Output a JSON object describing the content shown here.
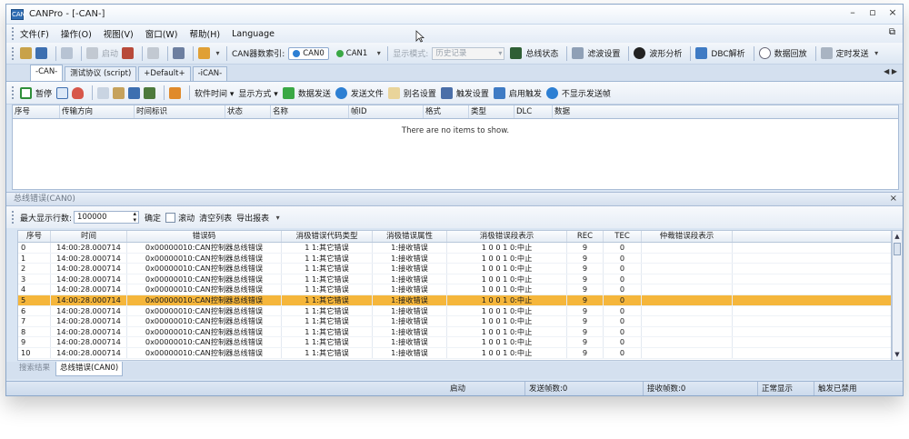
{
  "window": {
    "title": "CANPro - [-CAN-]",
    "app_icon_text": "CAN"
  },
  "menu": [
    "文件(F)",
    "操作(O)",
    "视图(V)",
    "窗口(W)",
    "帮助(H)",
    "Language"
  ],
  "toolbar1": {
    "start_label": "启动",
    "index_label": "CAN器数索引:",
    "channels": [
      {
        "label": "CAN0",
        "color": "#2d7fd3"
      },
      {
        "label": "CAN1",
        "color": "#3aa845"
      }
    ],
    "display_mode_label": "显示模式:",
    "display_mode_value": "历史记录",
    "bus_status_label": "总线状态",
    "filter_label": "滤波设置",
    "waveform_label": "波形分析",
    "dbc_label": "DBC解析",
    "replay_label": "数据回放",
    "timed_send_label": "定时发送"
  },
  "tabs": [
    "-CAN-",
    "测试协议 (script)",
    "+Default+",
    "-iCAN-"
  ],
  "toolbar2": {
    "pause_label": "暂停",
    "software_time_label": "软件时间",
    "display_style_label": "显示方式",
    "data_send_label": "数据发送",
    "file_send_label": "发送文件",
    "alias_label": "别名设置",
    "trigger_setting_label": "触发设置",
    "enable_trigger_label": "启用触发",
    "hide_send_label": "不显示发送帧"
  },
  "main_grid": {
    "columns": [
      "序号",
      "传输方向",
      "时间标识",
      "状态",
      "名称",
      "帧ID",
      "格式",
      "类型",
      "DLC",
      "数据"
    ],
    "empty_text": "There are no items to show."
  },
  "error_panel": {
    "title": "总线错误(CAN0)",
    "max_rows_label": "最大显示行数:",
    "max_rows_value": "100000",
    "confirm_label": "确定",
    "scroll_label": "滚动",
    "clear_label": "清空列表",
    "export_label": "导出报表",
    "columns": [
      "序号",
      "时间",
      "错误码",
      "消极错误代码类型",
      "消极错误属性",
      "消极错误段表示",
      "REC",
      "TEC",
      "仲裁错误段表示"
    ],
    "rows": [
      {
        "no": "0",
        "time": "14:00:28.000714",
        "code": "0x00000010:CAN控制器总线错误",
        "type": "1 1:其它错误",
        "attr": "1:接收错误",
        "seg": "1 0 0 1 0:中止",
        "rec": "9",
        "tec": "0",
        "arb": ""
      },
      {
        "no": "1",
        "time": "14:00:28.000714",
        "code": "0x00000010:CAN控制器总线错误",
        "type": "1 1:其它错误",
        "attr": "1:接收错误",
        "seg": "1 0 0 1 0:中止",
        "rec": "9",
        "tec": "0",
        "arb": ""
      },
      {
        "no": "2",
        "time": "14:00:28.000714",
        "code": "0x00000010:CAN控制器总线错误",
        "type": "1 1:其它错误",
        "attr": "1:接收错误",
        "seg": "1 0 0 1 0:中止",
        "rec": "9",
        "tec": "0",
        "arb": ""
      },
      {
        "no": "3",
        "time": "14:00:28.000714",
        "code": "0x00000010:CAN控制器总线错误",
        "type": "1 1:其它错误",
        "attr": "1:接收错误",
        "seg": "1 0 0 1 0:中止",
        "rec": "9",
        "tec": "0",
        "arb": ""
      },
      {
        "no": "4",
        "time": "14:00:28.000714",
        "code": "0x00000010:CAN控制器总线错误",
        "type": "1 1:其它错误",
        "attr": "1:接收错误",
        "seg": "1 0 0 1 0:中止",
        "rec": "9",
        "tec": "0",
        "arb": ""
      },
      {
        "no": "5",
        "time": "14:00:28.000714",
        "code": "0x00000010:CAN控制器总线错误",
        "type": "1 1:其它错误",
        "attr": "1:接收错误",
        "seg": "1 0 0 1 0:中止",
        "rec": "9",
        "tec": "0",
        "arb": ""
      },
      {
        "no": "6",
        "time": "14:00:28.000714",
        "code": "0x00000010:CAN控制器总线错误",
        "type": "1 1:其它错误",
        "attr": "1:接收错误",
        "seg": "1 0 0 1 0:中止",
        "rec": "9",
        "tec": "0",
        "arb": ""
      },
      {
        "no": "7",
        "time": "14:00:28.000714",
        "code": "0x00000010:CAN控制器总线错误",
        "type": "1 1:其它错误",
        "attr": "1:接收错误",
        "seg": "1 0 0 1 0:中止",
        "rec": "9",
        "tec": "0",
        "arb": ""
      },
      {
        "no": "8",
        "time": "14:00:28.000714",
        "code": "0x00000010:CAN控制器总线错误",
        "type": "1 1:其它错误",
        "attr": "1:接收错误",
        "seg": "1 0 0 1 0:中止",
        "rec": "9",
        "tec": "0",
        "arb": ""
      },
      {
        "no": "9",
        "time": "14:00:28.000714",
        "code": "0x00000010:CAN控制器总线错误",
        "type": "1 1:其它错误",
        "attr": "1:接收错误",
        "seg": "1 0 0 1 0:中止",
        "rec": "9",
        "tec": "0",
        "arb": ""
      },
      {
        "no": "10",
        "time": "14:00:28.000714",
        "code": "0x00000010:CAN控制器总线错误",
        "type": "1 1:其它错误",
        "attr": "1:接收错误",
        "seg": "1 0 0 1 0:中止",
        "rec": "9",
        "tec": "0",
        "arb": ""
      }
    ],
    "selected_index": 5,
    "selected_color": "#f5b63b"
  },
  "bottom_tabs": [
    "搜索结果",
    "总线错误(CAN0)"
  ],
  "status": {
    "state": "启动",
    "sent_frames": "发送帧数:0",
    "recv_frames": "接收帧数:0",
    "display_state": "正常显示",
    "trigger_state": "触发已禁用"
  }
}
